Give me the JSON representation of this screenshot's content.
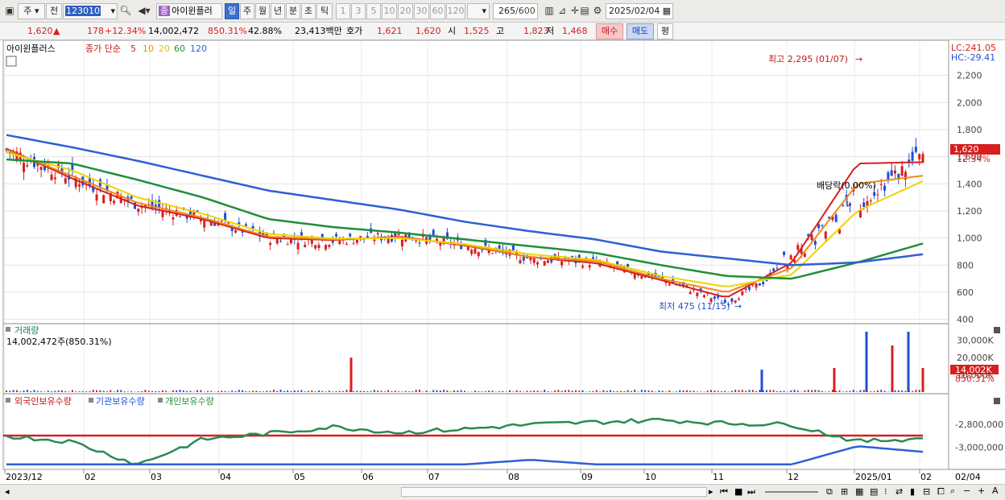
{
  "toolbar": {
    "period_type": "주",
    "all": "전",
    "code": "123010",
    "name_badge": "종",
    "name": "아이윈플러",
    "intervals": [
      "일",
      "주",
      "월",
      "년",
      "분",
      "초",
      "틱"
    ],
    "active_interval": "일",
    "numbers": [
      "1",
      "3",
      "5",
      "10",
      "20",
      "30",
      "60",
      "120"
    ],
    "count": "265",
    "count_max": "/600",
    "date": "2025/02/04"
  },
  "info": {
    "price": "1,620",
    "change": "178",
    "change_pct": "+12.34%",
    "volume": "14,002,472",
    "volume_pct": "850.31%",
    "turnover": "42.88%",
    "amount": "23,413백만",
    "ask_label": "호가",
    "ask": "1,621",
    "bid": "1,620",
    "open_label": "시",
    "open": "1,525",
    "high_label": "고",
    "high": "1,823",
    "low_label": "저",
    "low": "1,468",
    "buy": "매수",
    "sell": "매도",
    "avg": "평"
  },
  "main_legend": {
    "name": "아이윈플러스",
    "ma_label": "종가 단순",
    "periods": [
      "5",
      "10",
      "20",
      "60",
      "120"
    ],
    "colors": [
      "#d81e1e",
      "#ee8a18",
      "#ecd400",
      "#1f8f3a",
      "#2e5fd6"
    ]
  },
  "labels": {
    "lc": "LC:241.05",
    "hc": "HC:-29.41",
    "high_note": "최고 2,295 (01/07)",
    "low_note": "최저 475 (11/15)",
    "div_note": "배당락(0.00%)",
    "price_tag": "1,620",
    "pct_tag": "12.34%",
    "vol_title": "거래량",
    "vol_text": "14,002,472주(850.31%)",
    "vol_tag": "14,002K",
    "vol_pct": "850.31%",
    "hold_foreign": "외국인보유수량",
    "hold_inst": "기관보유수량",
    "hold_indiv": "개인보유수량",
    "last_date": "02/04"
  },
  "colors": {
    "up": "#d81e1e",
    "down": "#1f4fd6",
    "hline": "#d81e1e"
  },
  "chart_data": [
    {
      "type": "candlestick",
      "title": "아이윈플러스",
      "ylim": [
        380,
        2400
      ],
      "y_ticks": [
        "2,200",
        "2,000",
        "1,800",
        "1,600",
        "1,400",
        "1,200",
        "1,000",
        "800",
        "600",
        "400"
      ],
      "x_ticks": [
        "2023/12",
        "02",
        "03",
        "04",
        "05",
        "06",
        "07",
        "08",
        "09",
        "10",
        "11",
        "12",
        "2025/01",
        "02"
      ],
      "x": [
        "2023-12",
        "2024-01",
        "2024-02",
        "2024-03",
        "2024-04",
        "2024-05",
        "2024-06",
        "2024-07",
        "2024-08",
        "2024-09",
        "2024-10",
        "2024-11",
        "2024-12",
        "2025-01",
        "2025-02"
      ],
      "close": [
        1650,
        1450,
        1250,
        1150,
        1000,
        980,
        1020,
        950,
        850,
        820,
        700,
        520,
        800,
        1250,
        1620
      ],
      "series": [
        {
          "name": "5",
          "values": [
            1660,
            1440,
            1240,
            1140,
            1000,
            985,
            1010,
            945,
            860,
            815,
            690,
            560,
            820,
            1550,
            1560
          ]
        },
        {
          "name": "10",
          "values": [
            1650,
            1460,
            1260,
            1150,
            1010,
            990,
            1005,
            950,
            860,
            830,
            700,
            600,
            780,
            1400,
            1460
          ]
        },
        {
          "name": "20",
          "values": [
            1630,
            1500,
            1300,
            1180,
            1030,
            995,
            1000,
            955,
            880,
            840,
            720,
            640,
            730,
            1200,
            1420
          ]
        },
        {
          "name": "60",
          "values": [
            1580,
            1550,
            1430,
            1300,
            1140,
            1080,
            1040,
            990,
            940,
            890,
            800,
            720,
            700,
            820,
            960
          ]
        },
        {
          "name": "120",
          "values": [
            1760,
            1670,
            1570,
            1460,
            1350,
            1280,
            1210,
            1120,
            1050,
            990,
            900,
            850,
            800,
            820,
            880
          ]
        }
      ],
      "annotations": [
        "최고 2,295 (01/07)",
        "최저 475 (11/15)",
        "배당락(0.00%)"
      ],
      "last_price": 1620
    },
    {
      "type": "bar",
      "title": "거래량",
      "ylim": [
        0,
        35000
      ],
      "y_ticks": [
        "30,000K",
        "20,000K",
        "10,000K"
      ],
      "x": [
        "2024-05-28",
        "2024-11-15",
        "2025-01-03",
        "2025-01-07",
        "2025-01-21",
        "2025-01-31",
        "2025-02-04"
      ],
      "values": [
        20000,
        13000,
        14000,
        38000,
        27000,
        35000,
        14000
      ],
      "unit": "K"
    },
    {
      "type": "line",
      "title": "외국인보유수량",
      "ylim": [
        -3180000,
        -2650000
      ],
      "y_ticks": [
        "-2,800,000",
        "-3,000,000"
      ],
      "series": [
        {
          "name": "외국인보유수량",
          "values": [
            -2900000,
            -2950000,
            -3150000,
            -2930000,
            -2880000,
            -2820000,
            -2870000,
            -2840000,
            -2800000,
            -2780000,
            -2760000,
            -2790000,
            -2800000,
            -2950000,
            -2920000
          ]
        },
        {
          "name": "기관보유수량",
          "values": [
            -3150000,
            -3150000,
            -3150000,
            -3150000,
            -3150000,
            -3150000,
            -3150000,
            -3150000,
            -3110000,
            -3150000,
            -3150000,
            -3150000,
            -3150000,
            -2990000,
            -3040000
          ]
        }
      ]
    }
  ]
}
